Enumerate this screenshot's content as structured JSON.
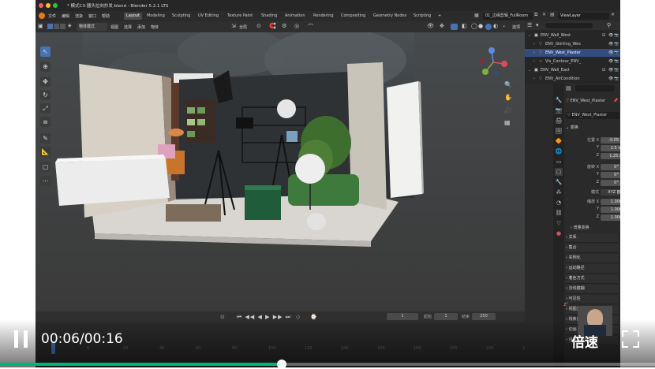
{
  "window": {
    "title": "* 模式C3-器头拉向抄发.blend - Blender 5.2.1 LTS",
    "scene": "01_边缘剪辑_FullRoom",
    "view_layer": "ViewLayer"
  },
  "menu": {
    "items": [
      "文件",
      "编辑",
      "渲染",
      "窗口",
      "帮助"
    ]
  },
  "workspaces": {
    "tabs": [
      "Layout",
      "Modeling",
      "Sculpting",
      "UV Editing",
      "Texture Paint",
      "Shading",
      "Animation",
      "Rendering",
      "Compositing",
      "Geometry Nodes",
      "Scripting"
    ],
    "active": "Layout",
    "add": "+"
  },
  "viewport_header": {
    "mode": "物体模式",
    "menus": [
      "视图",
      "选择",
      "添加",
      "物体"
    ],
    "transform_orientation": "全局",
    "options_label": "选项"
  },
  "outliner": {
    "search_placeholder": "",
    "rows": [
      {
        "label": "ENV_Wall_West",
        "indent": 0
      },
      {
        "label": "ENV_Skirting_Wes",
        "indent": 1
      },
      {
        "label": "ENV_West_Plaster",
        "indent": 1
      },
      {
        "label": "Vis_Contour_ENV_",
        "indent": 1
      },
      {
        "label": "ENV_Wall_East",
        "indent": 0
      },
      {
        "label": "ENV_AirCondition",
        "indent": 1
      }
    ]
  },
  "properties": {
    "object_name": "ENV_West_Plaster",
    "data_name": "ENV_West_Plaster",
    "transform_title": "变换",
    "location": {
      "label": "位置 X",
      "x": "-0.05 m",
      "y": "2.5 m",
      "z": "1.25 m"
    },
    "rotation": {
      "label": "旋转 X",
      "x": "0°",
      "y": "0°",
      "z": "0°"
    },
    "mode_label": "模式",
    "mode_value": "XYZ 欧拉",
    "scale": {
      "label": "缩放 X",
      "x": "1.000",
      "y": "1.000",
      "z": "1.000"
    },
    "axis_y": "Y",
    "axis_z": "Z",
    "delta_transform": "增量变换",
    "sections": [
      "关系",
      "集合",
      "实例化",
      "运动路径",
      "着色方式",
      "法线模糊",
      "可见性",
      "视图显示",
      "线条画",
      "动画",
      "自定义属性"
    ]
  },
  "timeline": {
    "current_frame": "1",
    "start_label": "起始",
    "start": "1",
    "end_label": "结束",
    "end": "250",
    "ticks": [
      "0",
      "20",
      "40",
      "60",
      "80",
      "100",
      "120",
      "140",
      "160",
      "180",
      "200",
      "220",
      "240"
    ]
  },
  "player": {
    "time": "00:06/00:16",
    "speed_label": "倍速",
    "progress": 0.43,
    "accent": "#00b578"
  },
  "colors": {
    "selection": "#4772b3",
    "header": "#2b2b2b"
  }
}
